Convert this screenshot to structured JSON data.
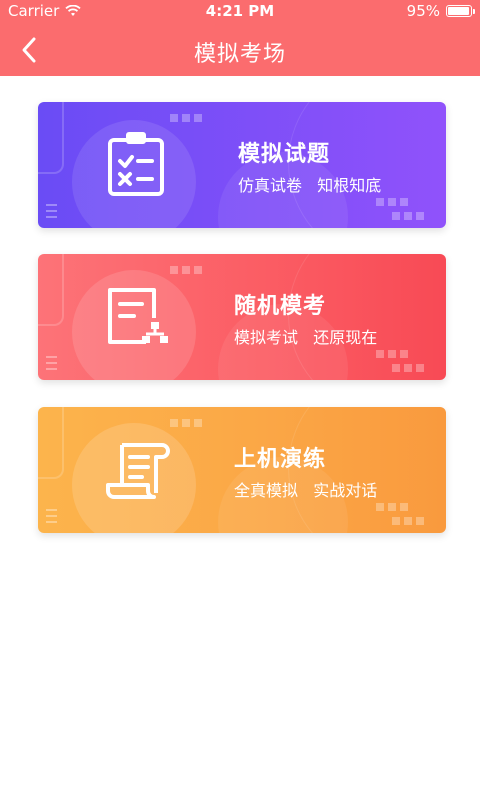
{
  "status": {
    "carrier": "Carrier",
    "time": "4:21 PM",
    "battery": "95%",
    "battery_level": 0.95
  },
  "nav": {
    "title": "模拟考场",
    "back_icon": "chevron-left-icon"
  },
  "cards": [
    {
      "title": "模拟试题",
      "subtitle": "仿真试卷   知根知底",
      "icon": "clipboard-checklist-icon",
      "color": "#7a4df7"
    },
    {
      "title": "随机模考",
      "subtitle": "模拟考试   还原现在",
      "icon": "document-org-chart-icon",
      "color": "#fb6067"
    },
    {
      "title": "上机演练",
      "subtitle": "全真模拟   实战对话",
      "icon": "scroll-document-icon",
      "color": "#fba746"
    }
  ]
}
